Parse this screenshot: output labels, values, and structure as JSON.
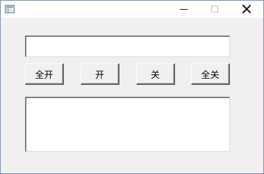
{
  "window": {
    "title": "",
    "icon": "app-window-icon"
  },
  "inputs": {
    "top_value": "",
    "log_value": ""
  },
  "buttons": {
    "all_on": "全开",
    "on": "开",
    "off": "关",
    "all_off": "全关"
  },
  "icons": {
    "minimize": "minimize-icon",
    "maximize": "maximize-icon",
    "close": "close-icon"
  }
}
